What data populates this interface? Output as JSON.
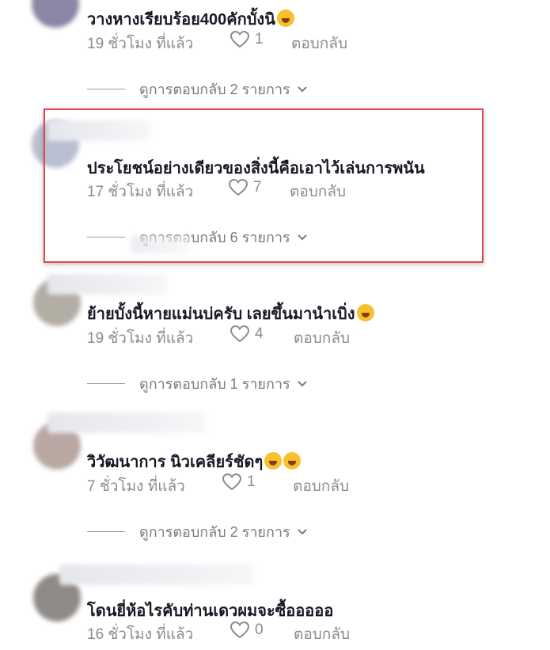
{
  "comments": [
    {
      "text": "วางหางเรียบร้อย400คักบั้งนิ",
      "emoji": "rofl-emoji",
      "time": "19 ชั่วโมง ที่แล้ว",
      "likes": "1",
      "reply": "ตอบกลับ",
      "view_replies": "ดูการตอบกลับ 2 รายการ"
    },
    {
      "text": "ประโยชน์อย่างเดียวของสิ่งนี้คือเอาไว้เล่นการพนัน",
      "time": "17 ชั่วโมง ที่แล้ว",
      "likes": "7",
      "reply": "ตอบกลับ",
      "view_replies": "ดูการตอบกลับ 6 รายการ",
      "highlighted": true
    },
    {
      "text": "ย้ายบั้งนี้หายแม่นบ่ครับ เลยขึ้นมานำเบิ่ง",
      "emoji": "joy-emoji",
      "time": "19 ชั่วโมง ที่แล้ว",
      "likes": "4",
      "reply": "ตอบกลับ",
      "view_replies": "ดูการตอบกลับ 1 รายการ"
    },
    {
      "text": "วิวัฒนาการ นิวเคลียร์ชัดๆ",
      "emoji": "rofl-emoji",
      "time": "7 ชั่วโมง ที่แล้ว",
      "likes": "1",
      "reply": "ตอบกลับ",
      "view_replies": "ดูการตอบกลับ 2 รายการ"
    },
    {
      "text": "โดนยี่ห้อไรคับท่านเดวผมจะซื้อออออ",
      "time": "16 ชั่วโมง ที่แล้ว",
      "likes": "0",
      "reply": "ตอบกลับ"
    }
  ],
  "colors": {
    "text": "#161823",
    "meta": "#8a8b91",
    "highlight_border": "#e0474c"
  }
}
